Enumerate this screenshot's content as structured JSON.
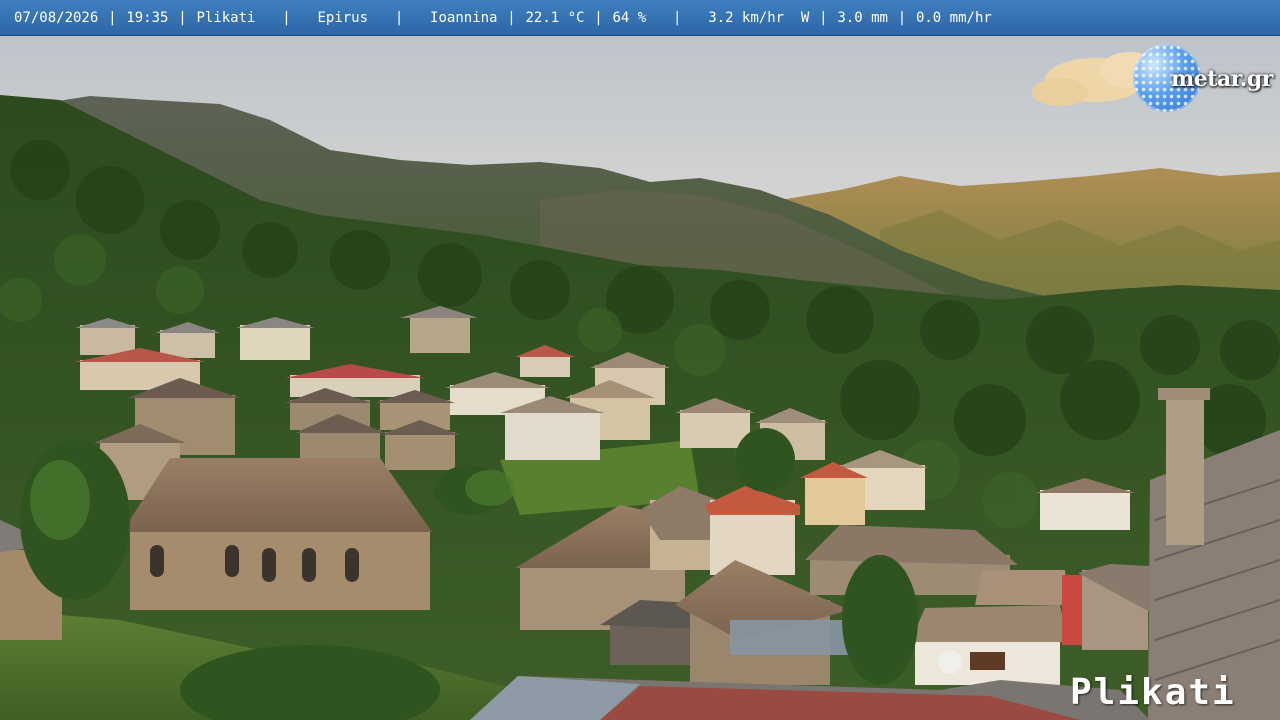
{
  "status_bar": {
    "date": "07/08/2026",
    "time": "19:35",
    "location": "Plikati",
    "region": "Epirus",
    "city": "Ioannina",
    "temperature": "22.1 °C",
    "humidity": "64 %",
    "wind": "3.2 km/hr  W",
    "rain": "3.0 mm",
    "rain_rate": "0.0 mm/hr",
    "separator": "|"
  },
  "logo": {
    "text": "metar.gr",
    "icon": "globe-icon",
    "color": "#4a8fe0"
  },
  "watermark": {
    "text": "Plikati"
  },
  "colors": {
    "bar": "#3470b0",
    "sky": "#c9ccd0",
    "forest": "#2f4a20"
  }
}
